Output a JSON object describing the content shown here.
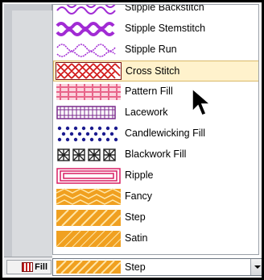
{
  "fill_button": {
    "label": "Fill"
  },
  "stitch_list": {
    "items": [
      {
        "label": "Stipple Backstitch",
        "icon": "stipple-backstitch-icon",
        "color": "#a12bd4"
      },
      {
        "label": "Stipple Stemstitch",
        "icon": "stipple-stemstitch-icon",
        "color": "#a12bd4"
      },
      {
        "label": "Stipple Run",
        "icon": "stipple-run-icon",
        "color": "#a12bd4"
      },
      {
        "label": "Cross Stitch",
        "icon": "cross-stitch-icon",
        "color": "#d31c1c",
        "selected": true
      },
      {
        "label": "Pattern Fill",
        "icon": "pattern-fill-icon",
        "color": "#e8658a"
      },
      {
        "label": "Lacework",
        "icon": "lacework-icon",
        "color": "#7a2a8c"
      },
      {
        "label": "Candlewicking Fill",
        "icon": "candlewicking-icon",
        "color": "#1b1b8f"
      },
      {
        "label": "Blackwork Fill",
        "icon": "blackwork-icon",
        "color": "#222222"
      },
      {
        "label": "Ripple",
        "icon": "ripple-icon",
        "color": "#d81e63"
      },
      {
        "label": "Fancy",
        "icon": "fancy-icon",
        "color": "#f0a020"
      },
      {
        "label": "Step",
        "icon": "step-icon",
        "color": "#f0a020"
      },
      {
        "label": "Satin",
        "icon": "satin-icon",
        "color": "#f0a020"
      }
    ]
  },
  "combo": {
    "value": "Step",
    "icon": "step-icon"
  },
  "cursor_icon": "arrow-cursor-icon"
}
